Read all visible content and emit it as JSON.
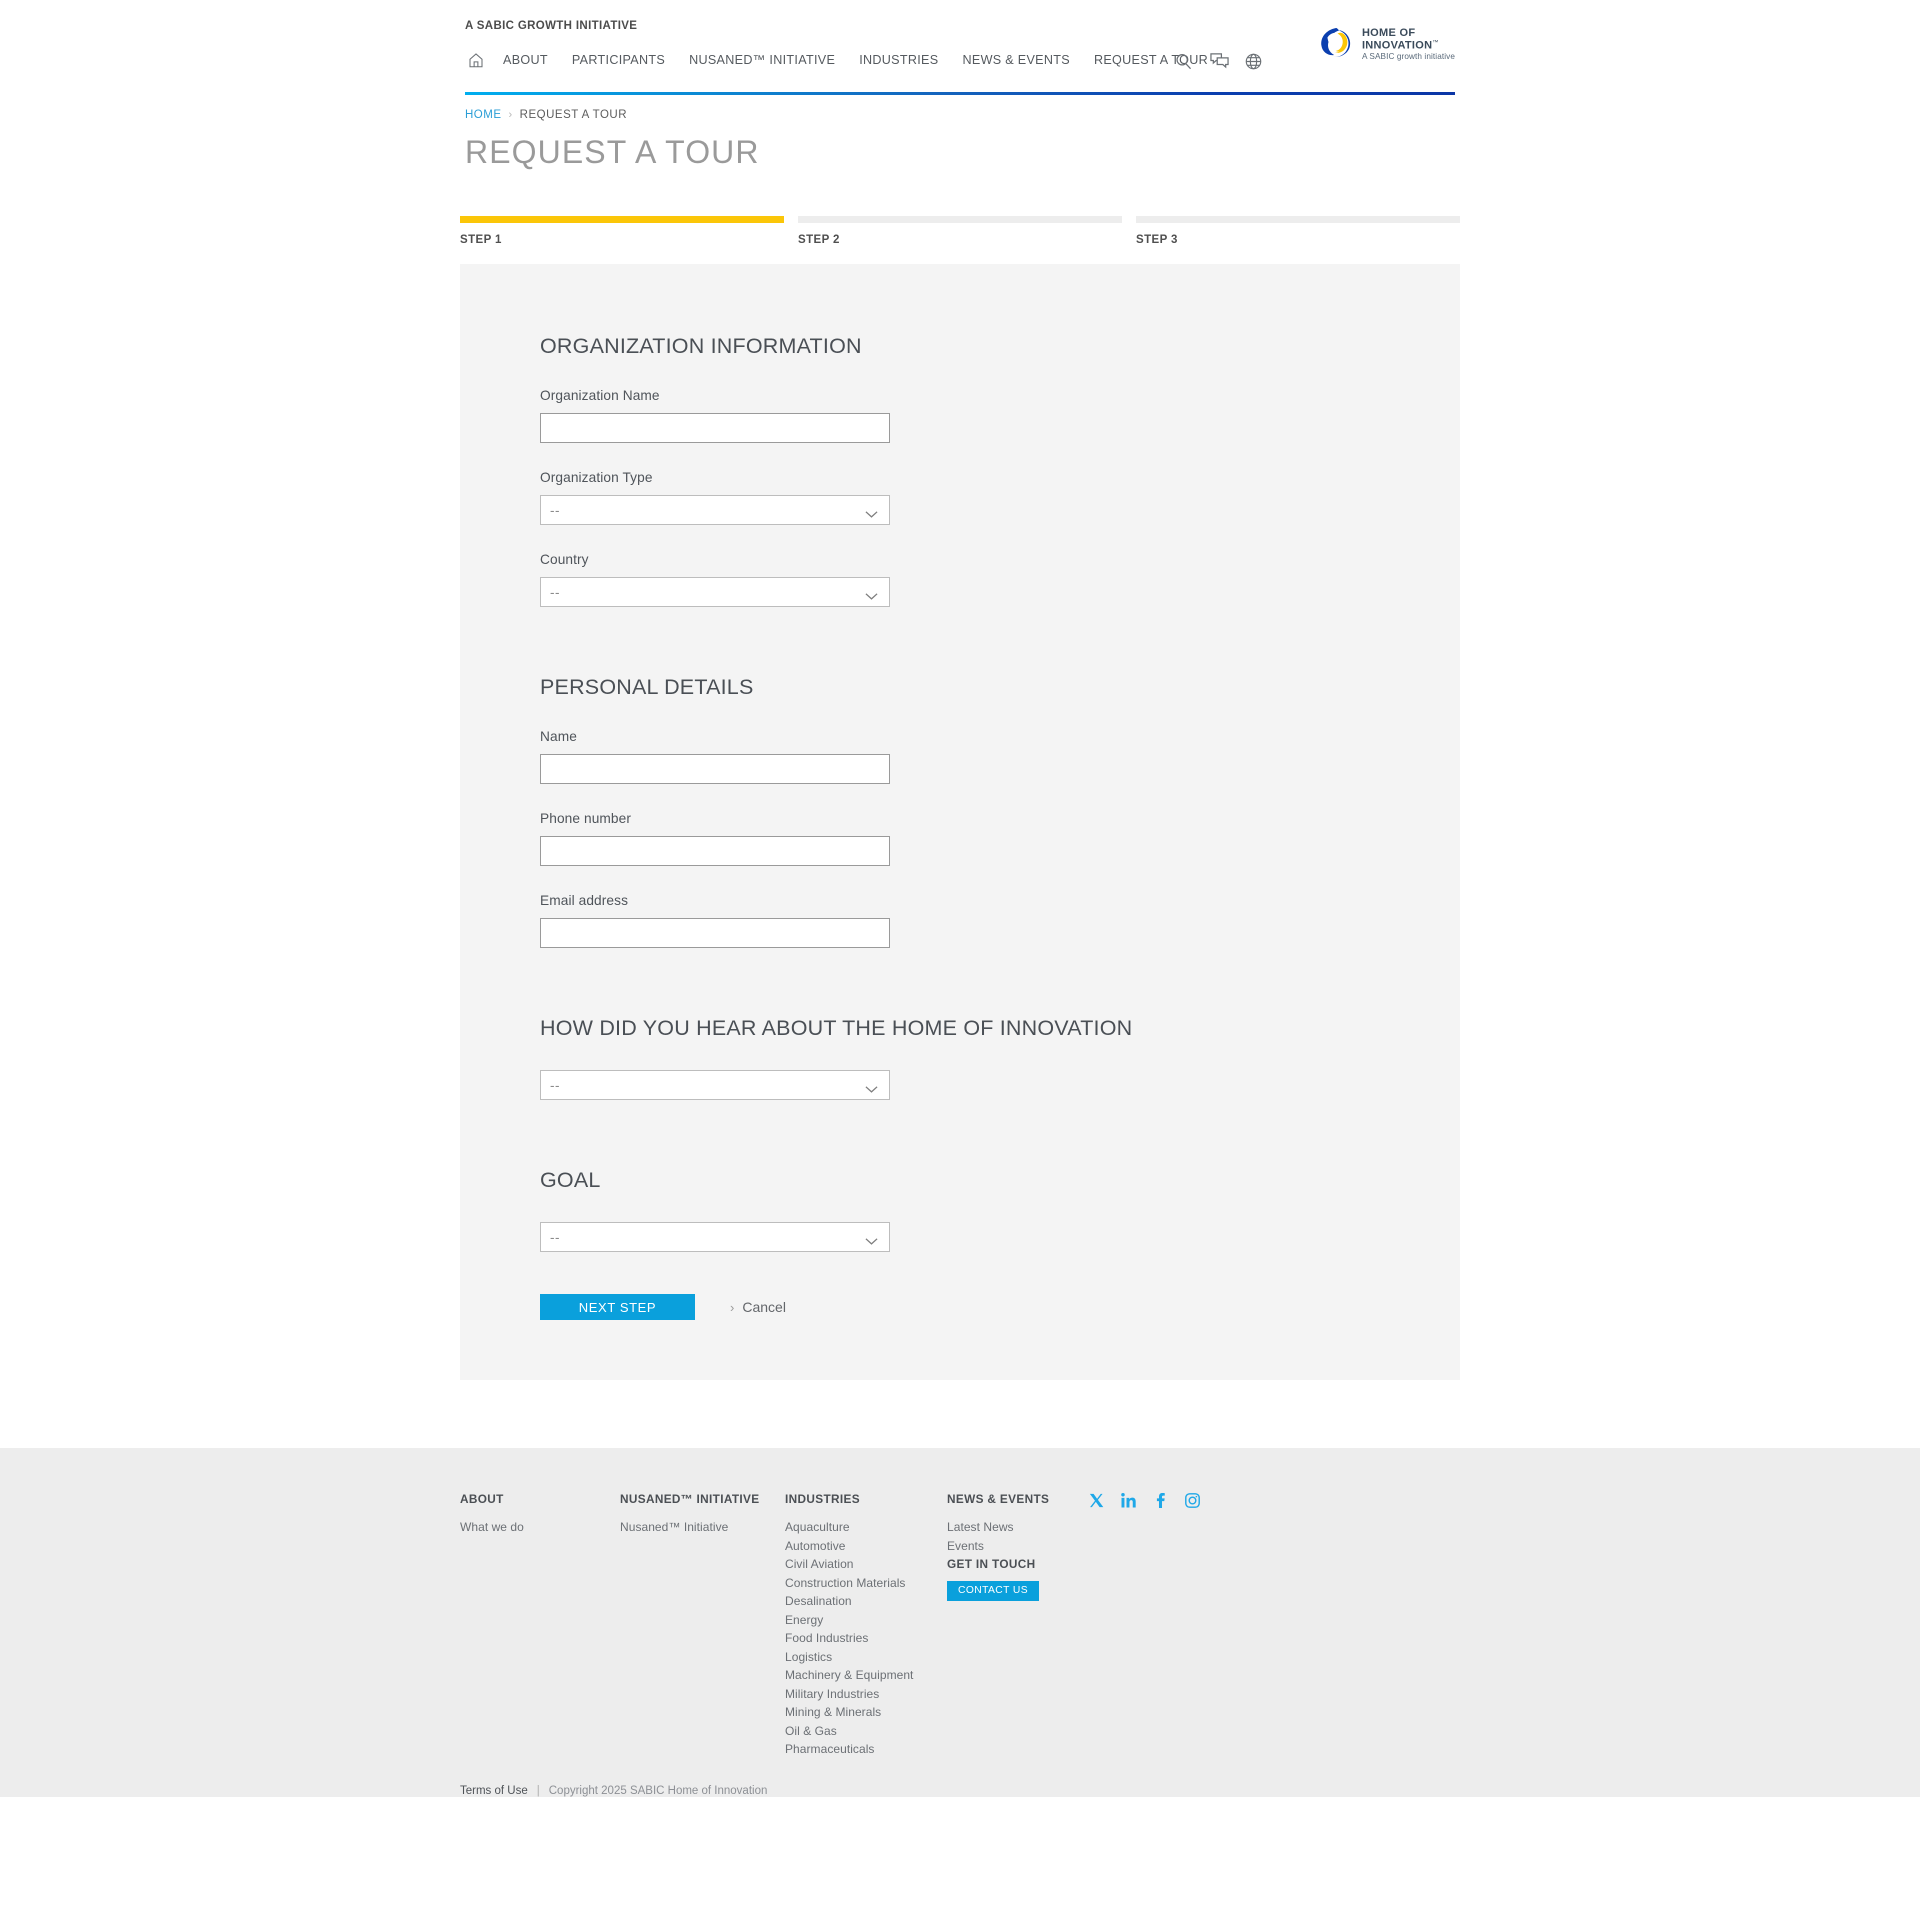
{
  "header": {
    "tagline": "A SABIC GROWTH INITIATIVE",
    "home_icon": "home-icon",
    "nav": [
      {
        "label": "ABOUT"
      },
      {
        "label": "PARTICIPANTS"
      },
      {
        "label": "NUSANED™ INITIATIVE"
      },
      {
        "label": "INDUSTRIES"
      },
      {
        "label": "NEWS & EVENTS"
      },
      {
        "label": "REQUEST A TOUR"
      }
    ],
    "tools": [
      {
        "name": "search-icon"
      },
      {
        "name": "chat-icon"
      },
      {
        "name": "globe-icon"
      }
    ],
    "brand": {
      "line1": "HOME OF",
      "line2": "INNOVATION",
      "line2_tm": "™",
      "line3": "A SABIC growth initiative",
      "mark": "ribbon-loop-logo"
    },
    "rule_gradient_from": "#00AEEF",
    "rule_gradient_to": "#0B36A6"
  },
  "breadcrumb": {
    "home": "HOME",
    "separator": "›",
    "current": "REQUEST A TOUR"
  },
  "page_title": "REQUEST A TOUR",
  "stepper": {
    "active_color": "#FBC608",
    "inactive_color": "#EDEDED",
    "steps": [
      {
        "label": "STEP 1",
        "active": true
      },
      {
        "label": "STEP 2",
        "active": false
      },
      {
        "label": "STEP 3",
        "active": false
      }
    ]
  },
  "form": {
    "sections": {
      "organization": {
        "title": "ORGANIZATION INFORMATION",
        "org_name_label": "Organization Name",
        "org_name_value": "",
        "org_name_placeholder": "",
        "org_type_label": "Organization Type",
        "org_type_value": "--",
        "country_label": "Country",
        "country_value": "--"
      },
      "personal": {
        "title": "PERSONAL DETAILS",
        "name_label": "Name",
        "name_value": "",
        "phone_label": "Phone number",
        "phone_value": "",
        "email_label": "Email address",
        "email_value": ""
      },
      "referral": {
        "title": "HOW DID YOU HEAR ABOUT THE HOME OF INNOVATION",
        "value": "--"
      },
      "goal": {
        "title": "GOAL",
        "value": "--"
      }
    },
    "actions": {
      "next_label": "NEXT STEP",
      "next_color": "#0AA0DC",
      "cancel_label": "Cancel",
      "cancel_chevron": "›"
    }
  },
  "footer": {
    "columns": [
      {
        "head": "ABOUT",
        "links": [
          "What we do"
        ]
      },
      {
        "head": "NUSANED™ INITIATIVE",
        "links": [
          "Nusaned™ Initiative"
        ]
      },
      {
        "head": "INDUSTRIES",
        "links": [
          "Aquaculture",
          "Automotive",
          "Civil Aviation",
          "Construction Materials",
          "Desalination",
          "Energy",
          "Food Industries",
          "Logistics",
          "Machinery & Equipment",
          "Military Industries",
          "Mining & Minerals",
          "Oil & Gas",
          "Pharmaceuticals"
        ]
      },
      {
        "head": "NEWS & EVENTS",
        "links": [
          "Latest News",
          "Events"
        ],
        "sub_head": "GET IN TOUCH",
        "button_label": "CONTACT US"
      }
    ],
    "socials": [
      {
        "name": "x-twitter-icon"
      },
      {
        "name": "linkedin-icon"
      },
      {
        "name": "facebook-icon"
      },
      {
        "name": "instagram-icon"
      }
    ],
    "social_color": "#1FA8E8",
    "bottom": {
      "terms": "Terms of Use",
      "separator": "|",
      "copyright": "Copyright 2025 SABIC Home of Innovation"
    }
  }
}
